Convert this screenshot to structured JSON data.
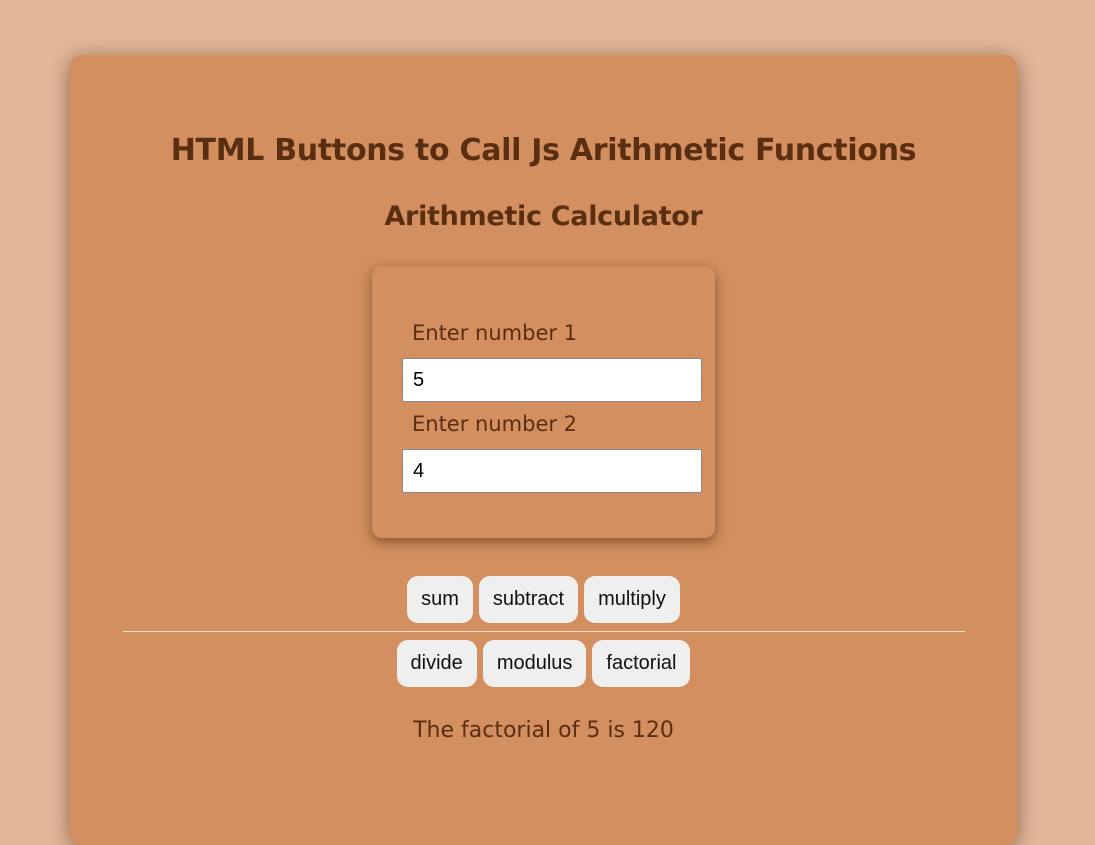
{
  "page": {
    "title": "HTML Buttons to Call Js Arithmetic Functions",
    "subtitle": "Arithmetic Calculator"
  },
  "inputs": {
    "number1": {
      "label": "Enter number 1",
      "value": "5"
    },
    "number2": {
      "label": "Enter number 2",
      "value": "4"
    }
  },
  "buttons": {
    "row1": {
      "sum": "sum",
      "subtract": "subtract",
      "multiply": "multiply"
    },
    "row2": {
      "divide": "divide",
      "modulus": "modulus",
      "factorial": "factorial"
    }
  },
  "result": {
    "text": "The factorial of 5 is 120"
  },
  "colors": {
    "background": "#e3b799",
    "card": "#d38f5f",
    "text": "#5a2e10",
    "button": "#efefef"
  }
}
